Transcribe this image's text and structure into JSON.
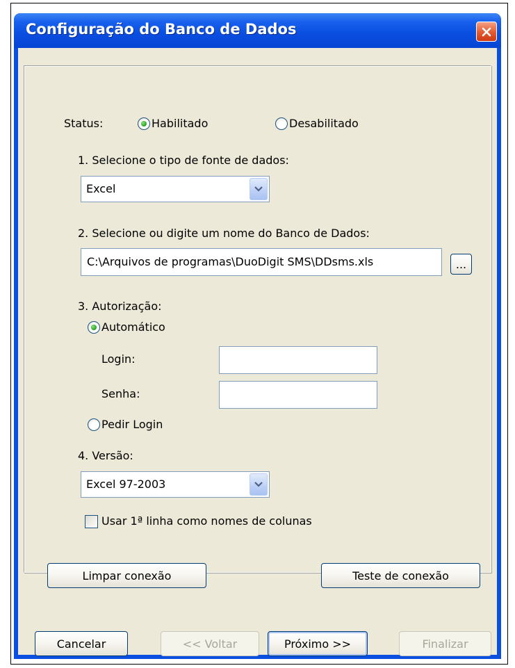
{
  "window": {
    "title": "Configuração do Banco de Dados"
  },
  "status": {
    "label": "Status:",
    "enabled_label": "Habilitado",
    "disabled_label": "Desabilitado"
  },
  "datasource": {
    "label": "1. Selecione o tipo de fonte de dados:",
    "selected": "Excel"
  },
  "database": {
    "label": "2. Selecione ou digite um nome do Banco de Dados:",
    "path": "C:\\Arquivos de programas\\DuoDigit SMS\\DDsms.xls",
    "browse_label": "..."
  },
  "auth": {
    "label": "3. Autorização:",
    "auto_label": "Automático",
    "login_label": "Login:",
    "login_value": "",
    "password_label": "Senha:",
    "password_value": "",
    "ask_login_label": "Pedir Login"
  },
  "version": {
    "label": "4. Versão:",
    "selected": "Excel 97-2003",
    "first_row_label": "Usar 1ª linha como nomes de colunas"
  },
  "actions": {
    "clear_label": "Limpar conexão",
    "test_label": "Teste de conexão"
  },
  "footer": {
    "cancel_label": "Cancelar",
    "back_label": "<< Voltar",
    "next_label": "Próximo >>",
    "finish_label": "Finalizar"
  },
  "colors": {
    "titlebar": "#0a4ee0",
    "client_bg": "#ece9d8",
    "close": "#e35a2f",
    "radio_dot": "#21a121"
  }
}
